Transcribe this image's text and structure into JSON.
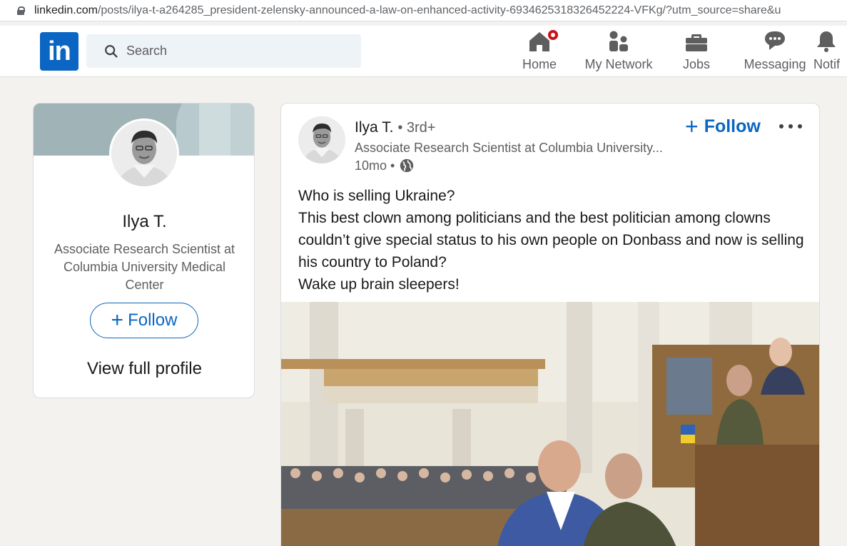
{
  "browser": {
    "url_host": "linkedin.com",
    "url_path": "/posts/ilya-t-a264285_president-zelensky-announced-a-law-on-enhanced-activity-6934625318326452224-VFKg/?utm_source=share&u"
  },
  "nav": {
    "logo_text": "in",
    "search_placeholder": "Search",
    "items": [
      {
        "label": "Home",
        "icon": "home-icon"
      },
      {
        "label": "My Network",
        "icon": "network-icon"
      },
      {
        "label": "Jobs",
        "icon": "briefcase-icon"
      },
      {
        "label": "Messaging",
        "icon": "messaging-icon"
      },
      {
        "label": "Notif",
        "icon": "bell-icon"
      }
    ],
    "accent": "#0a66c2",
    "badge_color": "#cc1016"
  },
  "profile_card": {
    "name": "Ilya T.",
    "headline": "Associate Research Scientist at Columbia University Medical Center",
    "follow_label": "Follow",
    "view_profile_label": "View full profile"
  },
  "post": {
    "author": "Ilya T.",
    "degree": "• 3rd+",
    "headline": "Associate Research Scientist at Columbia University...",
    "time": "10mo •",
    "follow_label": "Follow",
    "text_lines": [
      "Who is selling Ukraine?",
      "This best clown among politicians and the best politician among clowns couldn’t give special status to his own people on Donbass and now is selling his country to Poland?",
      "Wake up brain sleepers!"
    ]
  }
}
